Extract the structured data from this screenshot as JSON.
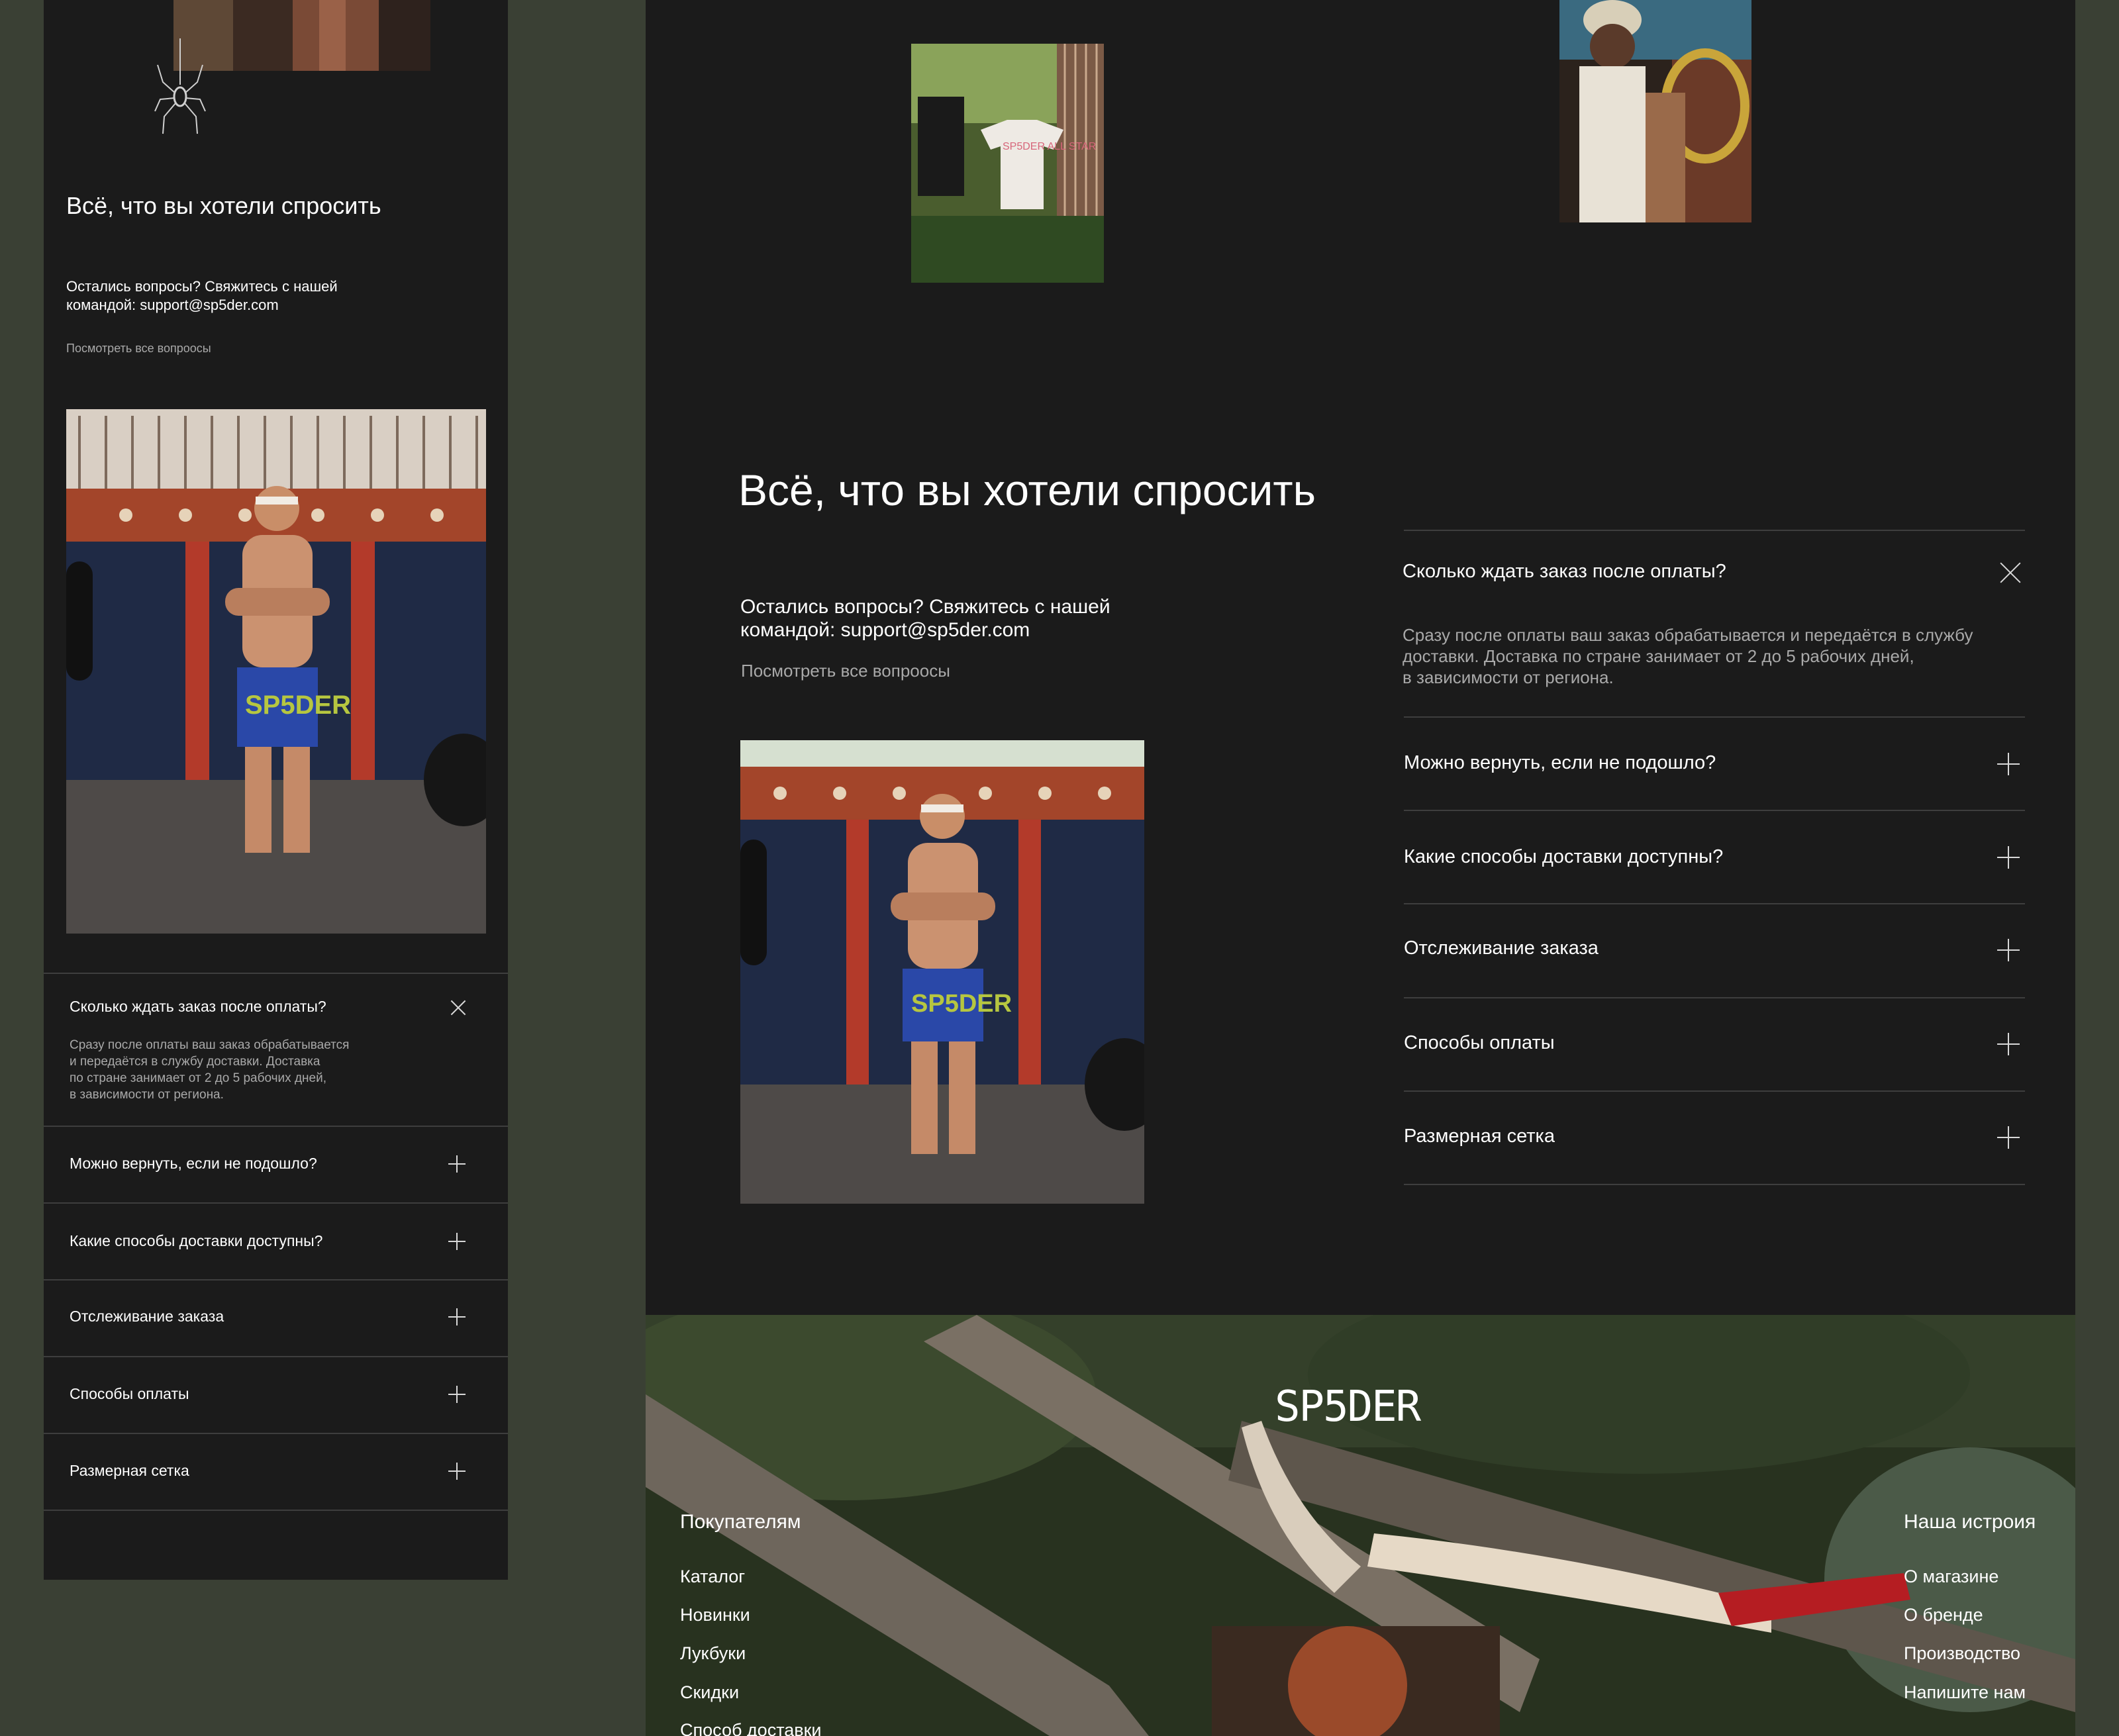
{
  "faq": {
    "title": "Всё, что вы хотели спросить",
    "contact_line1": "Остались вопросы? Свяжитесь с нашей",
    "contact_line2": "командой: support@sp5der.com",
    "view_all": "Посмотреть все вопроосы",
    "items": [
      {
        "question": "Сколько ждать заказ после оплаты?",
        "expanded": true,
        "answer_desktop": [
          "Сразу после оплаты ваш заказ обрабатывается и передаётся в службу",
          "доставки. Доставка по стране занимает от 2 до 5 рабочих дней,",
          "в зависимости от региона."
        ],
        "answer_mobile": [
          "Сразу после оплаты ваш заказ обрабатывается",
          "и передаётся в службу доставки. Доставка",
          "по стране занимает от 2 до 5 рабочих дней,",
          "в зависимости от региона."
        ]
      },
      {
        "question": "Можно вернуть, если не подошло?",
        "expanded": false
      },
      {
        "question": "Какие способы доставки доступны?",
        "expanded": false
      },
      {
        "question": "Отслеживание заказа",
        "expanded": false
      },
      {
        "question": "Способы оплаты",
        "expanded": false
      },
      {
        "question": "Размерная сетка",
        "expanded": false
      }
    ]
  },
  "footer": {
    "logo": "SP5DER",
    "col_left": {
      "heading": "Покупателям",
      "links": [
        "Каталог",
        "Новинки",
        "Лукбуки",
        "Скидки",
        "Способ доставки"
      ]
    },
    "col_right": {
      "heading": "Наша истроия",
      "links": [
        "О магазине",
        "О бренде",
        "Производство",
        "Напишите нам"
      ]
    }
  },
  "photos": {
    "shirt_text": "SP5DER ALL STAR",
    "shorts_text": "SP5DER"
  }
}
